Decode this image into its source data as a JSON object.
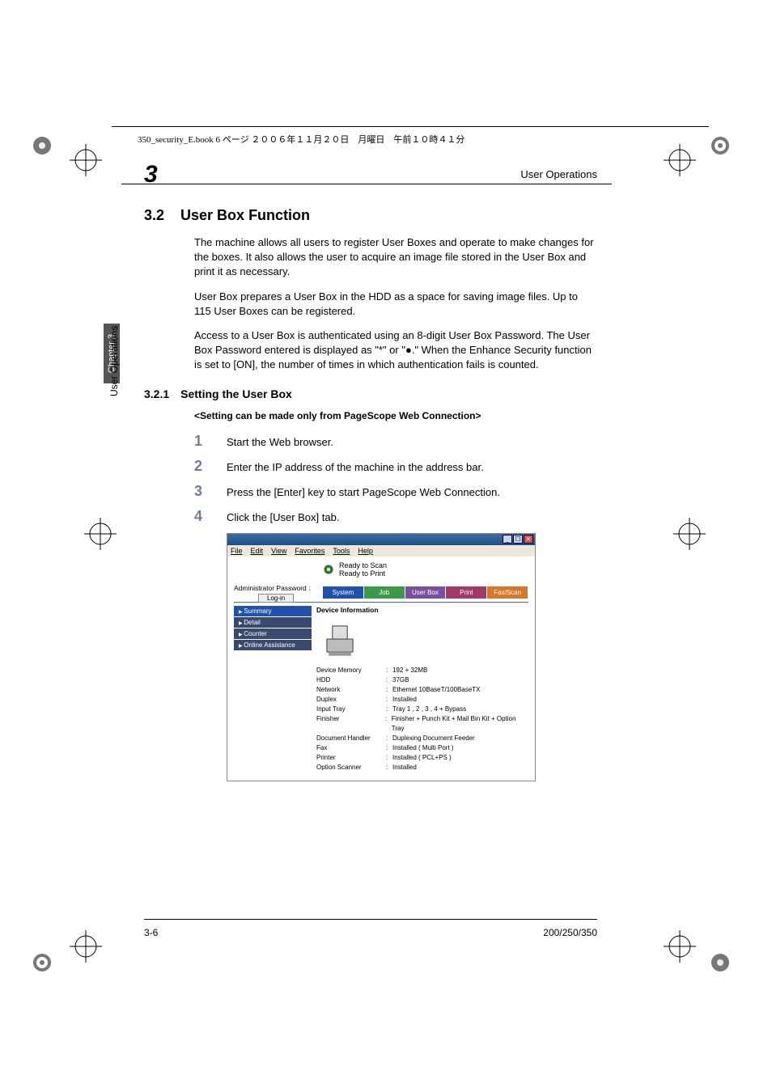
{
  "book_meta": "350_security_E.book  6 ページ  ２００６年１１月２０日　月曜日　午前１０時４１分",
  "header": {
    "chapter_num": "3",
    "title": "User Operations"
  },
  "side": {
    "tab": "Chapter 3",
    "label": "User Operations"
  },
  "footer": {
    "left": "3-6",
    "right": "200/250/350"
  },
  "section": {
    "num": "3.2",
    "title": "User Box Function"
  },
  "paras": [
    "The machine allows all users to register User Boxes and operate to make changes for the boxes. It also allows the user to acquire an image file stored in the User Box and print it as necessary.",
    "User Box prepares a User Box in the HDD as a space for saving image files. Up to 115 User Boxes can be registered.",
    "Access to a User Box is authenticated using an 8-digit User Box Password. The User Box Password entered is displayed as \"*\" or \"●.\" When the Enhance Security function is set to [ON], the number of times in which authentication fails is counted."
  ],
  "subsection": {
    "num": "3.2.1",
    "title": "Setting the User Box"
  },
  "instruction_bold": "<Setting can be made only from PageScope Web Connection>",
  "steps": [
    "Start the Web browser.",
    "Enter the IP address of the machine in the address bar.",
    "Press the [Enter] key to start PageScope Web Connection.",
    "Click the [User Box] tab."
  ],
  "screenshot": {
    "menubar": [
      "File",
      "Edit",
      "View",
      "Favorites",
      "Tools",
      "Help"
    ],
    "status": [
      "Ready to Scan",
      "Ready to Print"
    ],
    "admin_label": "Administrator Password :",
    "login_label": "Log-in",
    "tabs": [
      "System",
      "Job",
      "User Box",
      "Print",
      "Fax/Scan"
    ],
    "nav": [
      "Summary",
      "Detail",
      "Counter",
      "Online Assistance"
    ],
    "panel_title": "Device Information",
    "info": [
      {
        "k": "Device Memory",
        "v": "192 + 32MB"
      },
      {
        "k": "HDD",
        "v": "37GB"
      },
      {
        "k": "Network",
        "v": "Ethernet 10BaseT/100BaseTX"
      },
      {
        "k": "Duplex",
        "v": "Installed"
      },
      {
        "k": "Input Tray",
        "v": "Tray 1 , 2 , 3 , 4 + Bypass"
      },
      {
        "k": "Finisher",
        "v": "Finisher + Punch Kit + Mail Bin Kit + Option Tray"
      },
      {
        "k": "Document Handler",
        "v": "Duplexing Document Feeder"
      },
      {
        "k": "Fax",
        "v": "Installed ( Multi Port )"
      },
      {
        "k": "Printer",
        "v": "Installed ( PCL+PS )"
      },
      {
        "k": "Option Scanner",
        "v": "Installed"
      }
    ]
  }
}
